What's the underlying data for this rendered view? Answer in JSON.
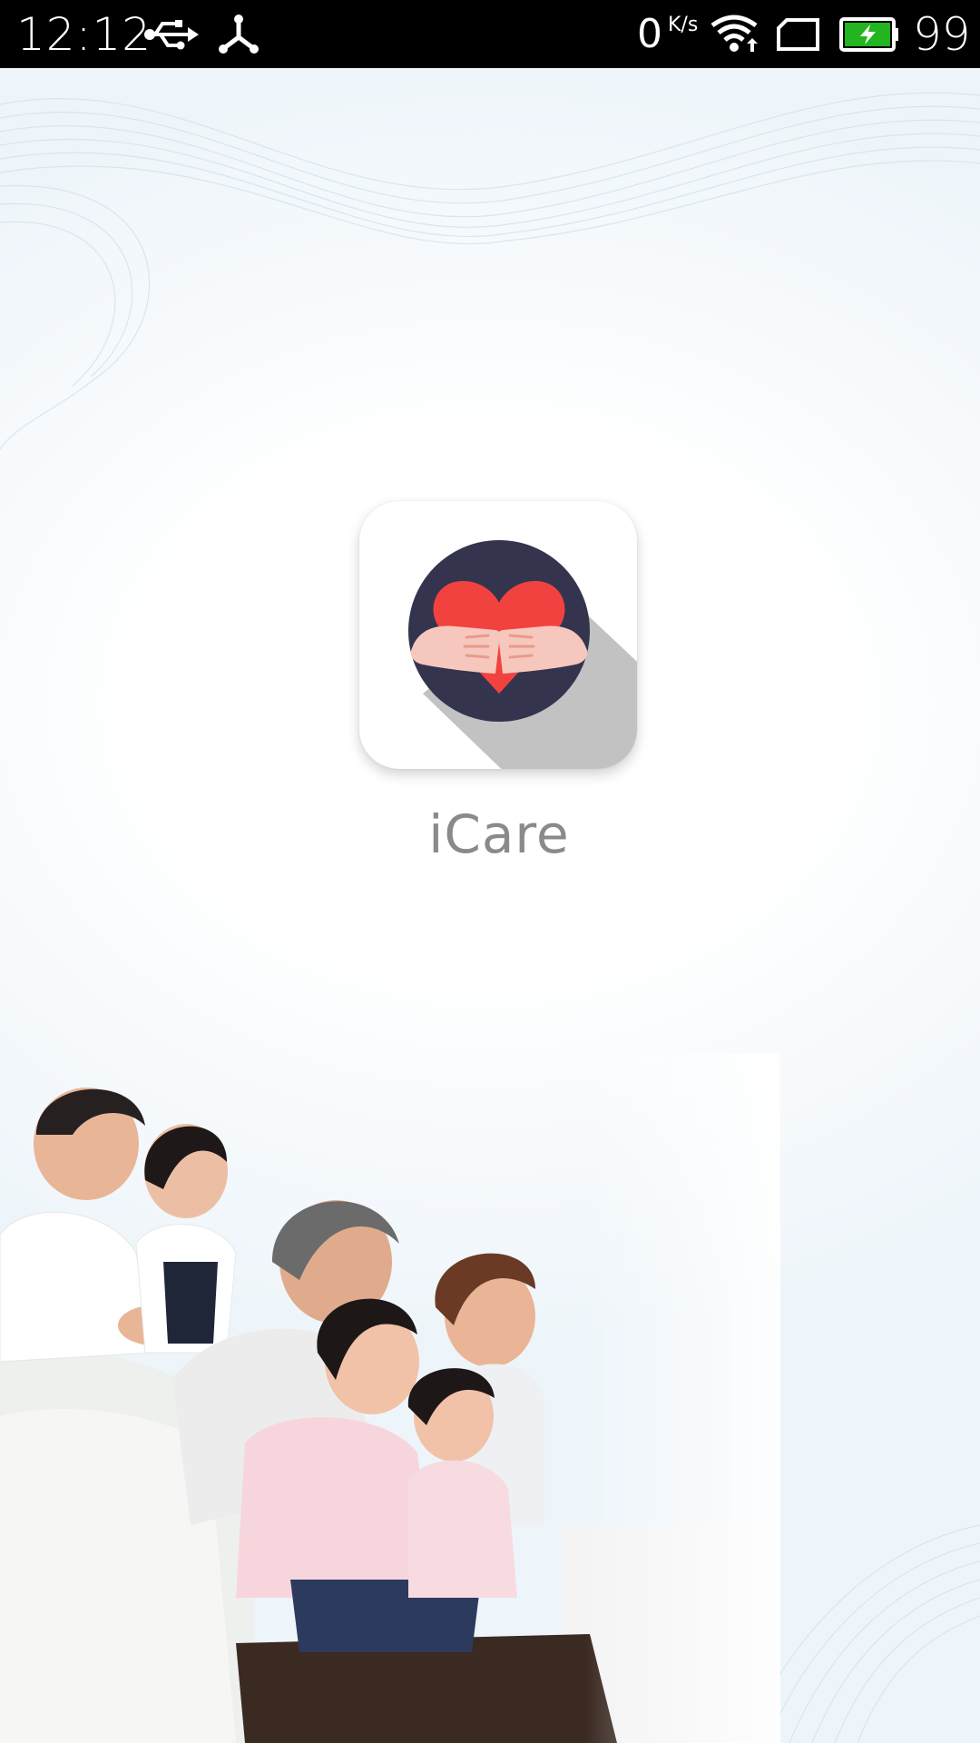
{
  "status_bar": {
    "time": "12:12",
    "network_speed": "0",
    "network_speed_unit": "K/s",
    "battery_level": "99",
    "icons": [
      "usb-icon",
      "debug-icon",
      "wifi-icon",
      "sim-icon",
      "battery-charging-icon"
    ],
    "battery_color": "#22b51f"
  },
  "splash": {
    "app_name": "iCare",
    "app_icon": "heart-in-hands-icon",
    "icon_colors": {
      "circle": "#34344e",
      "heart": "#f2423f",
      "hands": "#f6c8bd",
      "long_shadow": "#c2c2c2"
    },
    "background_image": "family-photo"
  }
}
